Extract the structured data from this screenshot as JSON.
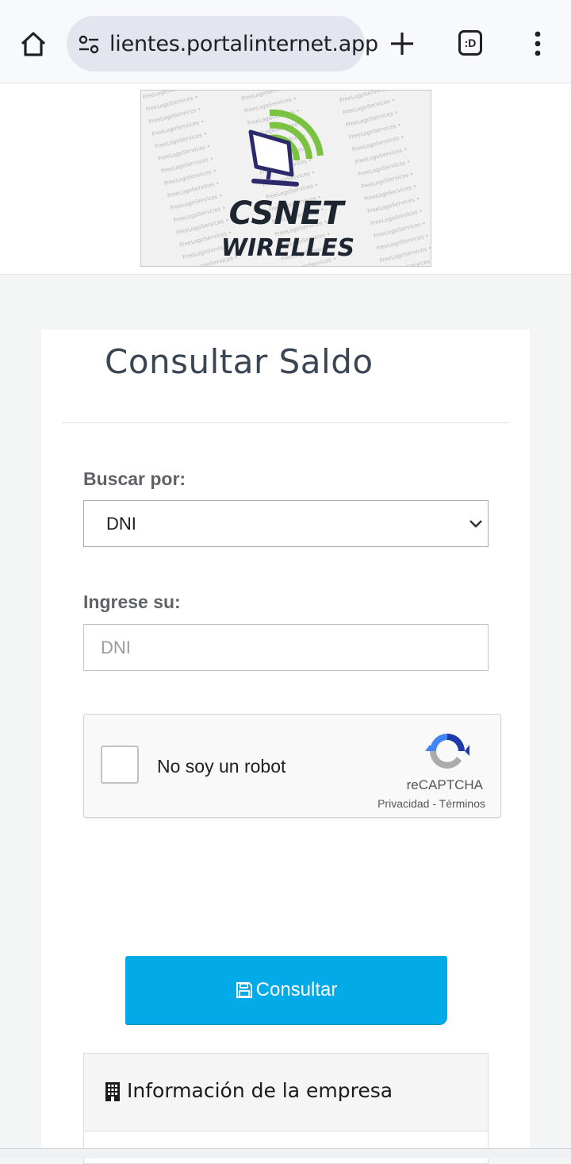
{
  "browser": {
    "url": "lientes.portalinternet.app",
    "tab_count_label": ":D",
    "icons": [
      "home-icon",
      "site-info-icon",
      "new-tab-icon",
      "tab-switcher-icon",
      "more-menu-icon"
    ]
  },
  "logo": {
    "line1": "CSNET",
    "line2": "WIRELLES",
    "watermark": "FreeLogoServices",
    "colors": {
      "signal": "#7cc242",
      "text": "#1d2530",
      "monitor": "#2c2a6b"
    }
  },
  "form": {
    "title": "Consultar Saldo",
    "search_by_label": "Buscar por:",
    "search_by_selected": "DNI",
    "enter_label": "Ingrese su:",
    "enter_placeholder": "DNI",
    "captcha": {
      "checkbox_label": "No soy un robot",
      "brand": "reCAPTCHA",
      "links": "Privacidad - Términos"
    },
    "submit_label": "Consultar",
    "accent_color": "#03aae8"
  },
  "info_panel": {
    "title": "Información de la empresa",
    "icon": "building-icon"
  }
}
